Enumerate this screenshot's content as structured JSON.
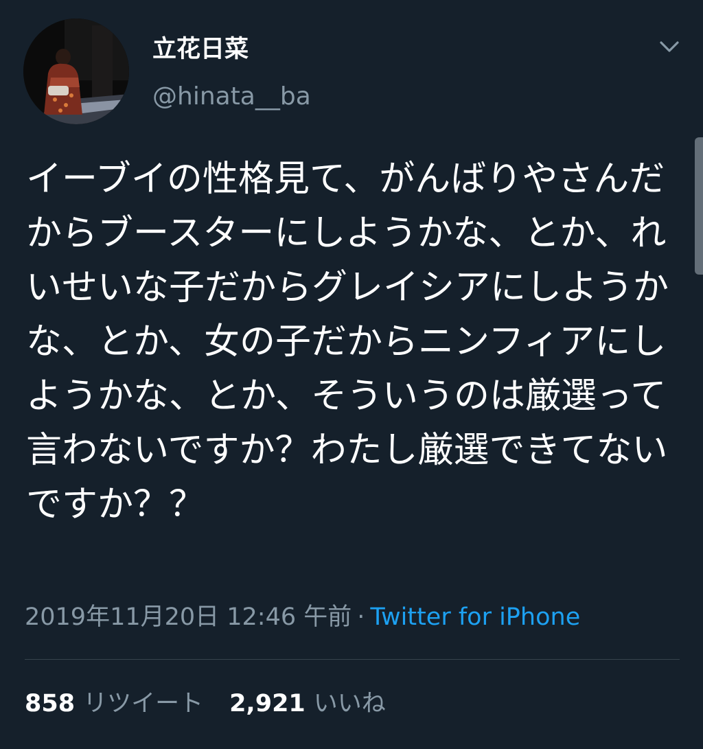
{
  "author": {
    "display_name": "立花日菜",
    "handle": "@hinata__ba"
  },
  "icons": {
    "menu": "chevron-down-icon"
  },
  "tweet": {
    "text": "イーブイの性格見て、がんばりやさんだからブースターにしようかな、とか、れいせいな子だからグレイシアにしようかな、とか、女の子だからニンフィアにしようかな、とか、そういうのは厳選って言わないですか？わたし厳選できてないですか？？",
    "timestamp": "2019年11月20日 12:46 午前",
    "separator": "·",
    "source": "Twitter for iPhone"
  },
  "stats": {
    "retweets_count": "858",
    "retweets_label": "リツイート",
    "likes_count": "2,921",
    "likes_label": "いいね"
  },
  "colors": {
    "background": "#15202b",
    "text_primary": "#ffffff",
    "text_secondary": "#8899a6",
    "link": "#1da1f2",
    "divider": "#38444d"
  }
}
